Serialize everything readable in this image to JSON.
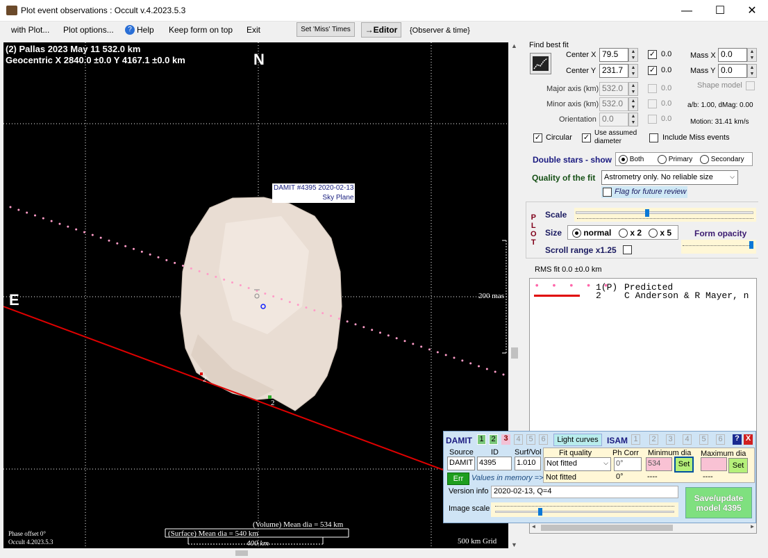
{
  "window": {
    "title": "Plot event observations : Occult v.4.2023.5.3",
    "min": "—",
    "max": "☐",
    "close": "✕"
  },
  "menu": {
    "with_plot": "with Plot...",
    "plot_options": "Plot options...",
    "help": "Help",
    "keep_on_top": "Keep form on top",
    "exit": "Exit",
    "set_miss": "Set 'Miss' Times",
    "editor": "→Editor",
    "observer_time": "{Observer & time}"
  },
  "plot": {
    "line1": "(2) Pallas  2023 May 11   532.0 km",
    "line2": "Geocentric  X  2840.0 ±0.0  Y 4167.1 ±0.0 km",
    "north": "N",
    "east": "E",
    "model_label1": "DAMIT #4395 2020-02-13",
    "model_label2": "Sky Plane",
    "scale_mas": "200 mas",
    "chord_label1": "2",
    "chord_label2": "2",
    "vol_dia": "(Volume) Mean dia = 534 km",
    "surf_dia": "(Surface) Mean dia = 540 km",
    "km_bar": "400 km",
    "phase": "Phase offset 0°",
    "occult_ver": "Occult 4.2023.5.3",
    "grid": "500 km Grid"
  },
  "fit": {
    "title": "Find best fit",
    "center_x_label": "Center X",
    "center_x": "79.5",
    "center_y_label": "Center Y",
    "center_y": "231.7",
    "cx_check": "0.0",
    "cy_check": "0.0",
    "mass_x_label": "Mass X",
    "mass_x": "0.0",
    "mass_y_label": "Mass Y",
    "mass_y": "0.0",
    "major_label": "Major axis (km)",
    "major": "532.0",
    "minor_label": "Minor axis (km)",
    "minor": "532.0",
    "orient_label": "Orientation",
    "orient": "0.0",
    "major_chk": "0.0",
    "minor_chk": "0.0",
    "orient_chk": "0.0",
    "shape_model": "Shape model",
    "ab": "a/b: 1.00, dMag: 0.00",
    "motion": "Motion: 31.41 km/s",
    "circular": "Circular",
    "use_assumed": "Use assumed",
    "diameter": "diameter",
    "include_miss": "Include Miss events"
  },
  "double": {
    "label": "Double stars - show",
    "both": "Both",
    "primary": "Primary",
    "secondary": "Secondary"
  },
  "quality": {
    "label": "Quality of the fit",
    "value": "Astrometry only. No reliable size",
    "flag": "Flag for future review"
  },
  "plotbox": {
    "p": "P",
    "l": "L",
    "o": "O",
    "t": "T",
    "scale": "Scale",
    "size": "Size",
    "normal": "normal",
    "x2": "x 2",
    "x5": "x 5",
    "form_opacity": "Form opacity",
    "scroll_range": "Scroll range x1.25"
  },
  "rms": "RMS fit 0.0 ±0.0 km",
  "legend": [
    {
      "num": "1(P)",
      "name": "Predicted"
    },
    {
      "num": "2",
      "name": "C Anderson & R Mayer, n"
    }
  ],
  "damit": {
    "label": "DAMIT",
    "n1": "1",
    "n2": "2",
    "n3": "3",
    "n4": "4",
    "n5": "5",
    "n6": "6",
    "light_curves": "Light curves",
    "isam": "ISAM",
    "i1": "1",
    "i2": "2",
    "i3": "3",
    "i4": "4",
    "i5": "5",
    "i6": "6",
    "help": "?",
    "close": "X",
    "source_h": "Source",
    "id_h": "ID",
    "surf_h": "Surf/Vol",
    "source": "DAMIT",
    "id": "4395",
    "surf": "1.010",
    "fitq_h": "Fit quality",
    "phcorr_h": "Ph Corr",
    "mindia_h": "Minimum dia",
    "maxdia_h": "Maximum dia",
    "fit_sel": "Not fitted",
    "phcorr": "0°",
    "mindia": "534",
    "set": "Set",
    "set2": "Set",
    "fit_mem": "Not fitted",
    "phcorr_mem": "0°",
    "min_mem": "----",
    "max_mem": "----",
    "err": "Err",
    "values_mem": "Values in memory =>",
    "version_label": "Version info",
    "version": "2020-02-13, Q=4",
    "image_scale": "Image scale",
    "save1": "Save/update",
    "save2": "model 4395"
  },
  "colors": {
    "chord": "#e00000",
    "predicted": "#ff9cc8",
    "asteroid": "#e9ddd3"
  }
}
